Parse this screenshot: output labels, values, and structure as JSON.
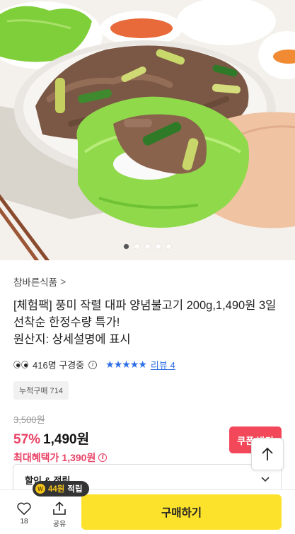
{
  "gallery": {
    "total": 5,
    "active": 0
  },
  "product": {
    "brand": "참바른식품",
    "brand_chevron": ">",
    "title_lines": [
      "[체험팩] 풍미 작렬 대파 양념불고기 200g,1,490원 3일",
      "선착순 한정수량 특가!",
      "원산지: 상세설명에 표시"
    ],
    "viewers": "416명 구경중",
    "rating_stars": "★★★★★",
    "review_link": "리뷰 4",
    "purchase_count": "누적구매 714",
    "original_price": "3,500원",
    "discount_rate": "57%",
    "price": "1,490원",
    "max_benefit_label": "최대혜택가",
    "max_benefit_price": "1,390원"
  },
  "coupon_button": "쿠폰 받기",
  "benefit_section": {
    "label": "할인 & 적립"
  },
  "reward_badge": {
    "coin": "W",
    "amount": "44원",
    "suffix": "적립"
  },
  "bottom_bar": {
    "like_count": "18",
    "share_label": "공유",
    "buy_label": "구매하기"
  },
  "colors": {
    "accent_pink": "#e94266",
    "link_blue": "#2b6ee6",
    "buy_yellow": "#fde22c",
    "coupon_red": "#f2485a"
  }
}
